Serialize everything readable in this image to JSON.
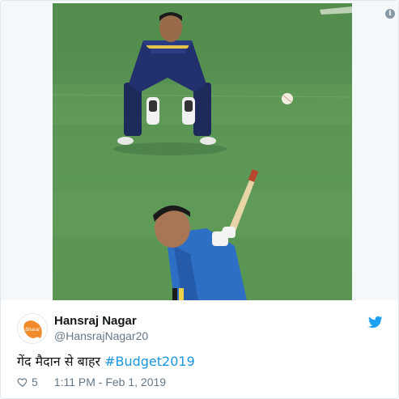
{
  "media": {
    "info_icon": "info-icon",
    "info_glyph": "i"
  },
  "user": {
    "display_name": "Hansraj Nagar",
    "handle": "@HansrajNagar20",
    "avatar_text": "Bharat"
  },
  "tweet": {
    "text_prefix": "गेंद मैदान से बाहर ",
    "hashtag": "#Budget2019"
  },
  "meta": {
    "likes": "5",
    "timestamp": "1:11 PM - Feb 1, 2019"
  },
  "colors": {
    "twitter_blue": "#1da1f2",
    "hashtag": "#1b95e0",
    "muted": "#657786"
  }
}
